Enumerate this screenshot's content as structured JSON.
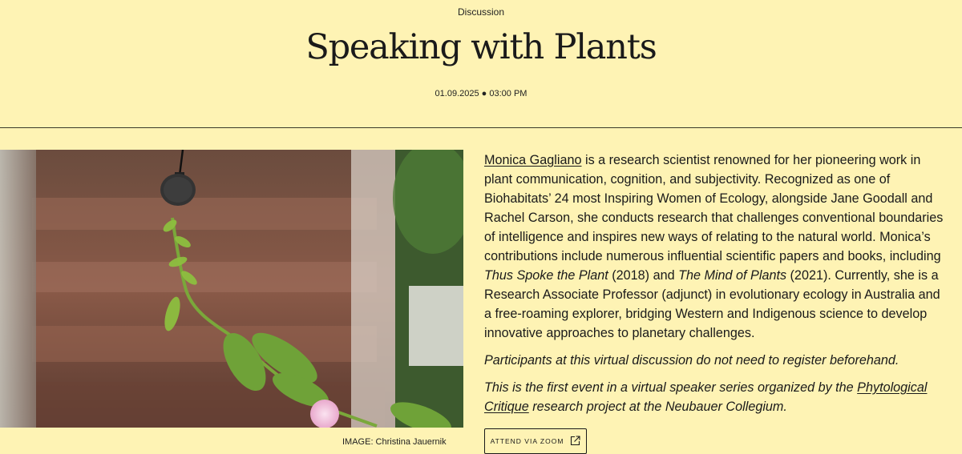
{
  "header": {
    "category": "Discussion",
    "title": "Speaking with Plants",
    "datetime": "01.09.2025 ● 03:00 PM"
  },
  "image": {
    "caption": "IMAGE: Christina Jauernik"
  },
  "content": {
    "p1": {
      "speaker_link": "Monica Gagliano",
      "text_a": " is a research scientist renowned for her pioneering work in plant communication, cognition, and subjectivity. Recognized as one of Biohabitats’ 24 most Inspiring Women of Ecology, alongside Jane Goodall and Rachel Carson, she conducts research that challenges conventional boundaries of intelligence and inspires new ways of relating to the natural world. Monica’s contributions include numerous influential scientific papers and books, including ",
      "book1": "Thus Spoke the Plant",
      "text_b": " (2018) and ",
      "book2": "The Mind of Plants",
      "text_c": " (2021). Currently, she is a Research Associate Professor (adjunct) in evolutionary ecology in Australia and a free-roaming explorer, bridging Western and Indigenous science to develop innovative approaches to planetary challenges."
    },
    "p2": "Participants at this virtual discussion do not need to register beforehand.",
    "p3": {
      "text_a": "This is the first event in a virtual speaker series organized by the ",
      "project_link": "Phytological Critique",
      "text_b": " research project at the Neubauer Collegium."
    }
  },
  "attend_button": {
    "label": "ATTEND VIA ZOOM",
    "icon": "external-link-icon"
  },
  "colors": {
    "background": "#fef3b4",
    "text": "#1a1a1a"
  }
}
